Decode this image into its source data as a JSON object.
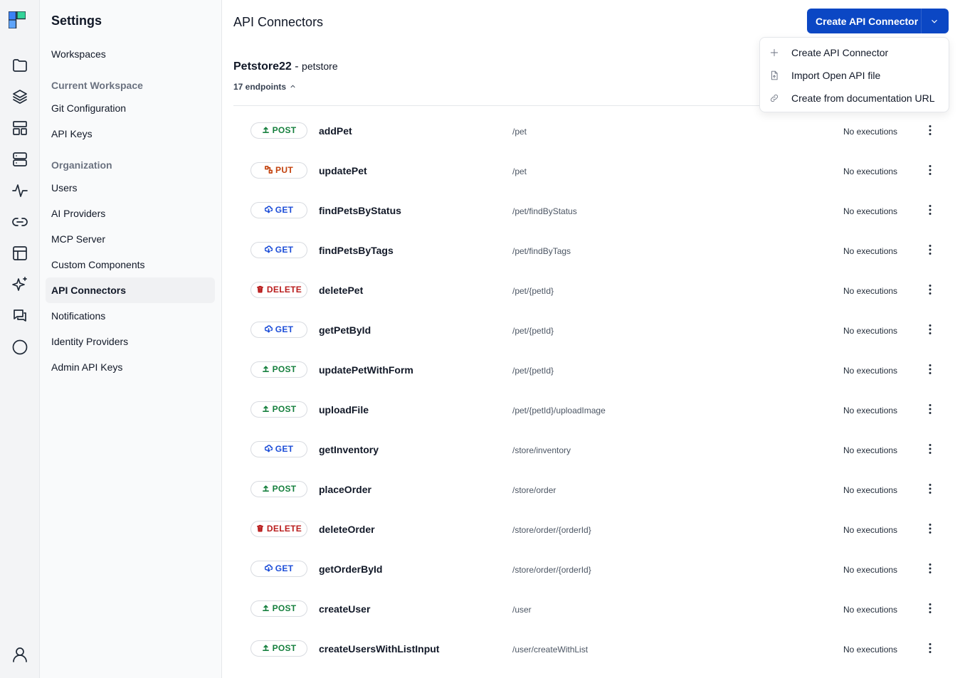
{
  "colors": {
    "primary": "#0b47c4",
    "post": "#157f3d",
    "put": "#c2410c",
    "get": "#1d4ed8",
    "delete": "#b91c1c"
  },
  "rail": {
    "icons": [
      "logo-icon",
      "folder-icon",
      "layers-icon",
      "layout-icon",
      "server-icon",
      "activity-icon",
      "link-icon",
      "table-icon",
      "sparkles-icon",
      "chat-icon",
      "circle-icon",
      "user-icon"
    ]
  },
  "sidebar": {
    "title": "Settings",
    "workspaces": "Workspaces",
    "current_workspace_header": "Current Workspace",
    "current_workspace_items": [
      "Git Configuration",
      "API Keys"
    ],
    "organization_header": "Organization",
    "organization_items": [
      "Users",
      "AI Providers",
      "MCP Server",
      "Custom Components",
      "API Connectors",
      "Notifications",
      "Identity Providers",
      "Admin API Keys"
    ],
    "active": "API Connectors"
  },
  "header": {
    "title": "API Connectors",
    "create_button": "Create API Connector"
  },
  "dropdown": {
    "items": [
      {
        "icon": "plus-icon",
        "label": "Create API Connector"
      },
      {
        "icon": "file-upload-icon",
        "label": "Import Open API file"
      },
      {
        "icon": "link-icon",
        "label": "Create from documentation URL"
      }
    ]
  },
  "connector": {
    "name": "Petstore22",
    "separator": " - ",
    "slug": "petstore",
    "endpoints_count": "17 endpoints"
  },
  "endpoints": [
    {
      "method": "POST",
      "name": "addPet",
      "path": "/pet",
      "status": "No executions"
    },
    {
      "method": "PUT",
      "name": "updatePet",
      "path": "/pet",
      "status": "No executions"
    },
    {
      "method": "GET",
      "name": "findPetsByStatus",
      "path": "/pet/findByStatus",
      "status": "No executions"
    },
    {
      "method": "GET",
      "name": "findPetsByTags",
      "path": "/pet/findByTags",
      "status": "No executions"
    },
    {
      "method": "DELETE",
      "name": "deletePet",
      "path": "/pet/{petId}",
      "status": "No executions"
    },
    {
      "method": "GET",
      "name": "getPetById",
      "path": "/pet/{petId}",
      "status": "No executions"
    },
    {
      "method": "POST",
      "name": "updatePetWithForm",
      "path": "/pet/{petId}",
      "status": "No executions"
    },
    {
      "method": "POST",
      "name": "uploadFile",
      "path": "/pet/{petId}/uploadImage",
      "status": "No executions"
    },
    {
      "method": "GET",
      "name": "getInventory",
      "path": "/store/inventory",
      "status": "No executions"
    },
    {
      "method": "POST",
      "name": "placeOrder",
      "path": "/store/order",
      "status": "No executions"
    },
    {
      "method": "DELETE",
      "name": "deleteOrder",
      "path": "/store/order/{orderId}",
      "status": "No executions"
    },
    {
      "method": "GET",
      "name": "getOrderById",
      "path": "/store/order/{orderId}",
      "status": "No executions"
    },
    {
      "method": "POST",
      "name": "createUser",
      "path": "/user",
      "status": "No executions"
    },
    {
      "method": "POST",
      "name": "createUsersWithListInput",
      "path": "/user/createWithList",
      "status": "No executions"
    }
  ]
}
